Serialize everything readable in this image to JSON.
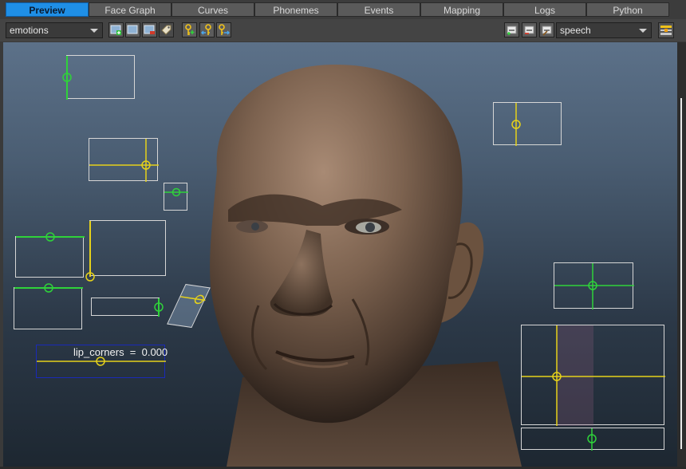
{
  "tabs": [
    {
      "label": "Preview",
      "active": true
    },
    {
      "label": "Face Graph",
      "active": false
    },
    {
      "label": "Curves",
      "active": false
    },
    {
      "label": "Phonemes",
      "active": false
    },
    {
      "label": "Events",
      "active": false
    },
    {
      "label": "Mapping",
      "active": false
    },
    {
      "label": "Logs",
      "active": false
    },
    {
      "label": "Python",
      "active": false
    }
  ],
  "toolbar": {
    "left_dropdown": "emotions",
    "right_dropdown": "speech",
    "buttons_left": [
      "add-frame-icon",
      "frame-icon",
      "remove-frame-icon",
      "tag-icon"
    ],
    "buttons_key": [
      "key-add-icon",
      "key-left-icon",
      "key-right-icon"
    ],
    "buttons_right": [
      "slider-add-icon",
      "slider-remove-icon",
      "slider-edit-icon"
    ],
    "settings_icon": "panel-settings-icon"
  },
  "viewport": {
    "lip_corners_label": "lip_corners",
    "lip_corners_value": "0.000",
    "lip_corners_text": "lip_corners  =  0.000"
  },
  "colors": {
    "active_tab": "#1f8fe6",
    "control_green": "#2fd23a",
    "control_yellow": "#e6d21a",
    "control_border": "#d6d6d6",
    "lip_box_border": "#1a2ab8"
  }
}
